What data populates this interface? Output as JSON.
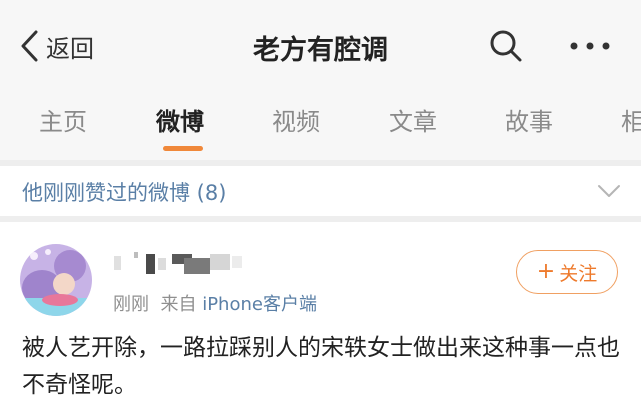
{
  "header": {
    "back_label": "返回",
    "title": "老方有腔调"
  },
  "tabs": [
    {
      "label": "主页"
    },
    {
      "label": "微博"
    },
    {
      "label": "视频"
    },
    {
      "label": "文章"
    },
    {
      "label": "故事"
    },
    {
      "label": "相"
    }
  ],
  "active_tab": "微博",
  "liked": {
    "label": "他刚刚赞过的微博 (8)"
  },
  "post": {
    "time": "刚刚",
    "source_prefix": "来自",
    "source": "iPhone客户端",
    "follow_label": "关注",
    "follow_plus": "+",
    "text": "被人艺开除，一路拉踩别人的宋轶女士做出来这种事一点也不奇怪呢。"
  },
  "colors": {
    "accent": "#f0883a",
    "link": "#5a7fa6",
    "follow": "#ee7a2c"
  }
}
